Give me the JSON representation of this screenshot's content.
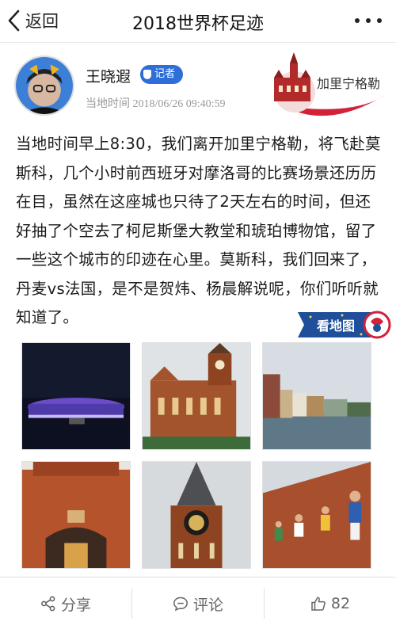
{
  "nav": {
    "back_label": "返回",
    "title": "2018世界杯足迹",
    "icons": {
      "back": "chevron-left-icon",
      "more": "more-dots-icon"
    }
  },
  "author": {
    "name": "王晓遐",
    "badge": "记者",
    "time": "当地时间 2018/06/26 09:40:59",
    "location": "加里宁格勒"
  },
  "post": {
    "text": "当地时间早上8:30，我们离开加里宁格勒，将飞赴莫斯科，几个小时前西班牙对摩洛哥的比赛场景还历历在目，虽然在这座城也只待了2天左右的时间，但还好抽了个空去了柯尼斯堡大教堂和琥珀博物馆，留了一些这个城市的印迹在心里。莫斯科，我们回来了，丹麦vs法国，是不是贺炜、杨晨解说呢，你们听听就知道了。",
    "map_button": "看地图"
  },
  "toolbar": {
    "share_label": "分享",
    "comment_label": "评论",
    "like_count": "82"
  },
  "colors": {
    "badge": "#2e6ed8",
    "map_button": "#1f4f9a",
    "accent_red": "#d4213a"
  }
}
